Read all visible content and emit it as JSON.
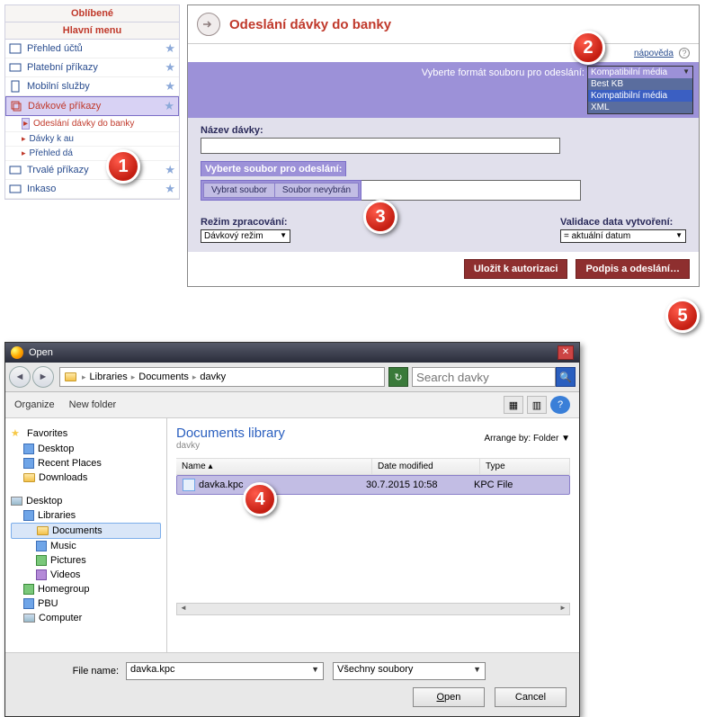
{
  "sidebar": {
    "header_fav": "Oblíbené",
    "header_main": "Hlavní menu",
    "items": [
      {
        "label": "Přehled účtů"
      },
      {
        "label": "Platební příkazy"
      },
      {
        "label": "Mobilní služby"
      },
      {
        "label": "Dávkové příkazy",
        "active": true
      },
      {
        "label": "Trvalé příkazy"
      },
      {
        "label": "Inkaso"
      }
    ],
    "subitems": [
      {
        "label": "Odeslání dávky do banky"
      },
      {
        "label": "Dávky k au"
      },
      {
        "label": "Přehled dá"
      }
    ]
  },
  "main": {
    "title": "Odeslání dávky do banky",
    "help": "nápověda",
    "format_label": "Vyberte formát souboru pro odeslání:",
    "format_selected": "Kompatibilní média",
    "format_options": [
      "Best KB",
      "Kompatibilní média",
      "XML"
    ],
    "name_label": "Název dávky:",
    "name_value": "",
    "file_label": "Vyberte soubor pro odeslání:",
    "file_btn": "Vybrat soubor",
    "file_status": "Soubor nevybrán",
    "mode_label": "Režim zpracování:",
    "mode_value": "Dávkový režim",
    "validation_label": "Validace data vytvoření:",
    "validation_value": "= aktuální datum",
    "save_btn": "Uložit k autorizaci",
    "sign_btn": "Podpis a odeslání…"
  },
  "dialog": {
    "title": "Open",
    "path": [
      "Libraries",
      "Documents",
      "davky"
    ],
    "search_placeholder": "Search davky",
    "organize": "Organize",
    "new_folder": "New folder",
    "tree_fav": "Favorites",
    "tree": {
      "desktop": "Desktop",
      "recent": "Recent Places",
      "downloads": "Downloads",
      "desktop2": "Desktop",
      "libraries": "Libraries",
      "documents": "Documents",
      "music": "Music",
      "pictures": "Pictures",
      "videos": "Videos",
      "homegroup": "Homegroup",
      "pbu": "PBU",
      "computer": "Computer"
    },
    "list_title": "Documents library",
    "list_sub": "davky",
    "arrange": "Arrange by:",
    "arrange_val": "Folder",
    "cols": {
      "name": "Name",
      "date": "Date modified",
      "type": "Type"
    },
    "rows": [
      {
        "name": "davka.kpc",
        "date": "30.7.2015 10:58",
        "type": "KPC File"
      }
    ],
    "filename_label": "File name:",
    "filename_value": "davka.kpc",
    "filter": "Všechny soubory",
    "open": "Open",
    "cancel": "Cancel"
  },
  "badges": {
    "b1": "1",
    "b2": "2",
    "b3": "3",
    "b4": "4",
    "b5": "5"
  }
}
